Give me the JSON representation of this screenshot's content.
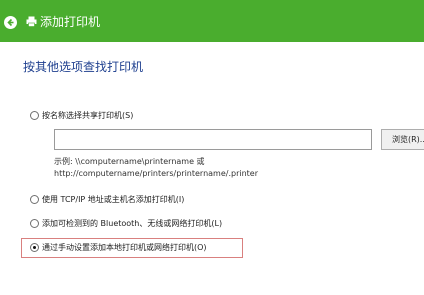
{
  "window": {
    "title": "添加打印机"
  },
  "main": {
    "heading": "按其他选项查找打印机",
    "options": [
      {
        "label": "按名称选择共享打印机(S)",
        "selected": false
      },
      {
        "label": "使用 TCP/IP 地址或主机名添加打印机(I)",
        "selected": false
      },
      {
        "label": "添加可检测到的 Bluetooth、无线或网络打印机(L)",
        "selected": false
      },
      {
        "label": "通过手动设置添加本地打印机或网络打印机(O)",
        "selected": true
      }
    ],
    "share_input": {
      "value": "",
      "placeholder": ""
    },
    "browse_label": "浏览(R)...",
    "example_line1": "示例: \\\\computername\\printername 或",
    "example_line2": "http://computername/printers/printername/.printer"
  },
  "colors": {
    "titlebar": "#4aad2e",
    "heading": "#1e3f8f",
    "highlight_border": "#d9807f"
  }
}
